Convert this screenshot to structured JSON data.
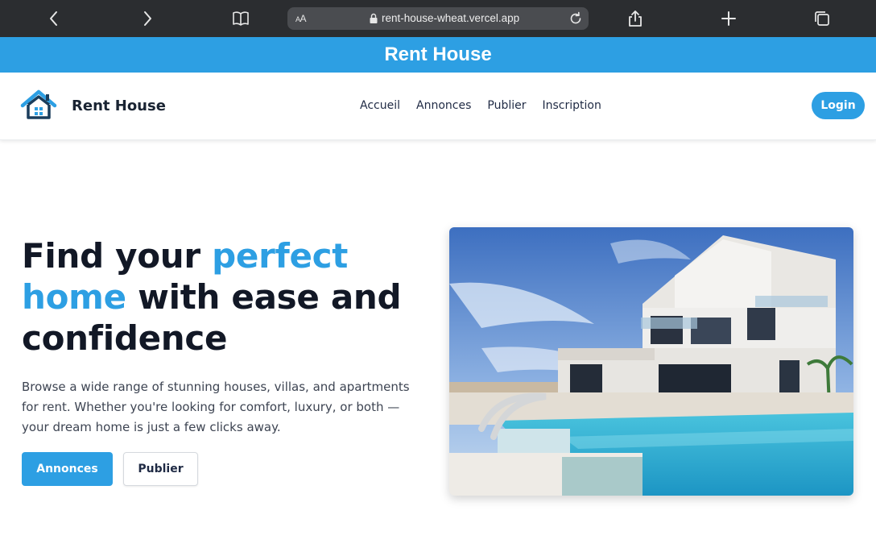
{
  "browser": {
    "text_size_label": "AA",
    "url": "rent-house-wheat.vercel.app",
    "icons": [
      "back-icon",
      "forward-icon",
      "bookmarks-icon",
      "lock-icon",
      "reload-icon",
      "share-icon",
      "new-tab-icon",
      "tabs-icon"
    ]
  },
  "banner": {
    "title": "Rent House"
  },
  "navbar": {
    "brand": "Rent House",
    "links": [
      "Accueil",
      "Annonces",
      "Publier",
      "Inscription"
    ],
    "login_label": "Login"
  },
  "hero": {
    "title_part1": "Find your ",
    "title_accent": "perfect home",
    "title_part2": " with ease and confidence",
    "description": "Browse a wide range of stunning houses, villas, and apartments for rent. Whether you're looking for comfort, luxury, or both — your dream home is just a few clicks away.",
    "primary_button": "Annonces",
    "secondary_button": "Publier"
  },
  "colors": {
    "accent": "#2d9fe3",
    "text_dark": "#121826",
    "chrome": "#2b2d30"
  }
}
